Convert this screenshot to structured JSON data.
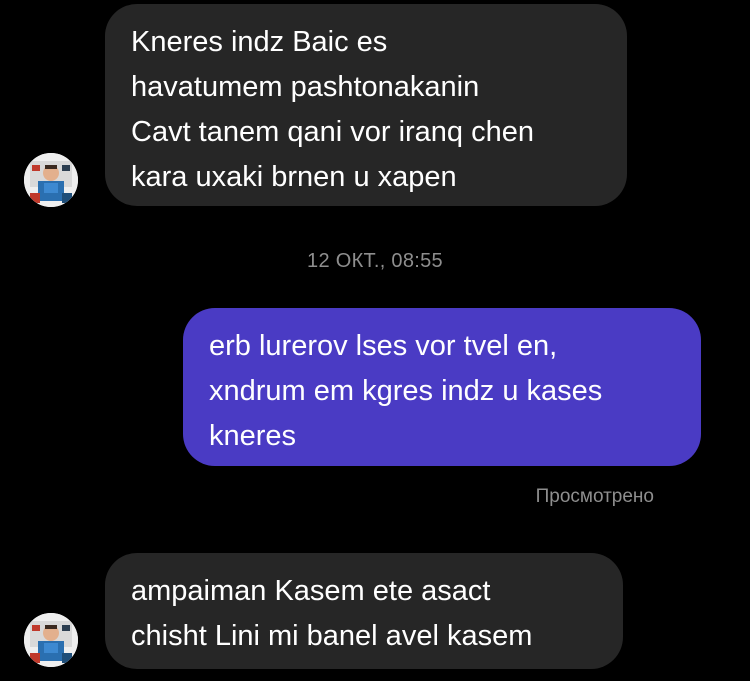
{
  "conversation": {
    "messages": [
      {
        "direction": "incoming",
        "text": "Kneres indz Baic es\nhavatumem pashtonakanin\nCavt tanem qani vor iranq chen\nkara uxaki brnen u xapen"
      },
      {
        "direction": "outgoing",
        "text": "erb lurerov lses vor tvel en,\nxndrum em kgres indz u kases\nkneres"
      },
      {
        "direction": "incoming",
        "text": "ampaiman Kasem ete asact\nchisht Lini mi banel avel kasem"
      }
    ],
    "timestamp": "12 ОКТ., 08:55",
    "seen_label": "Просмотрено"
  },
  "colors": {
    "background": "#000000",
    "incoming_bubble": "#262626",
    "outgoing_bubble": "#4a3bc4",
    "meta_text": "#8e8e8e"
  },
  "icons": {
    "avatar": "contact-avatar-icon"
  }
}
